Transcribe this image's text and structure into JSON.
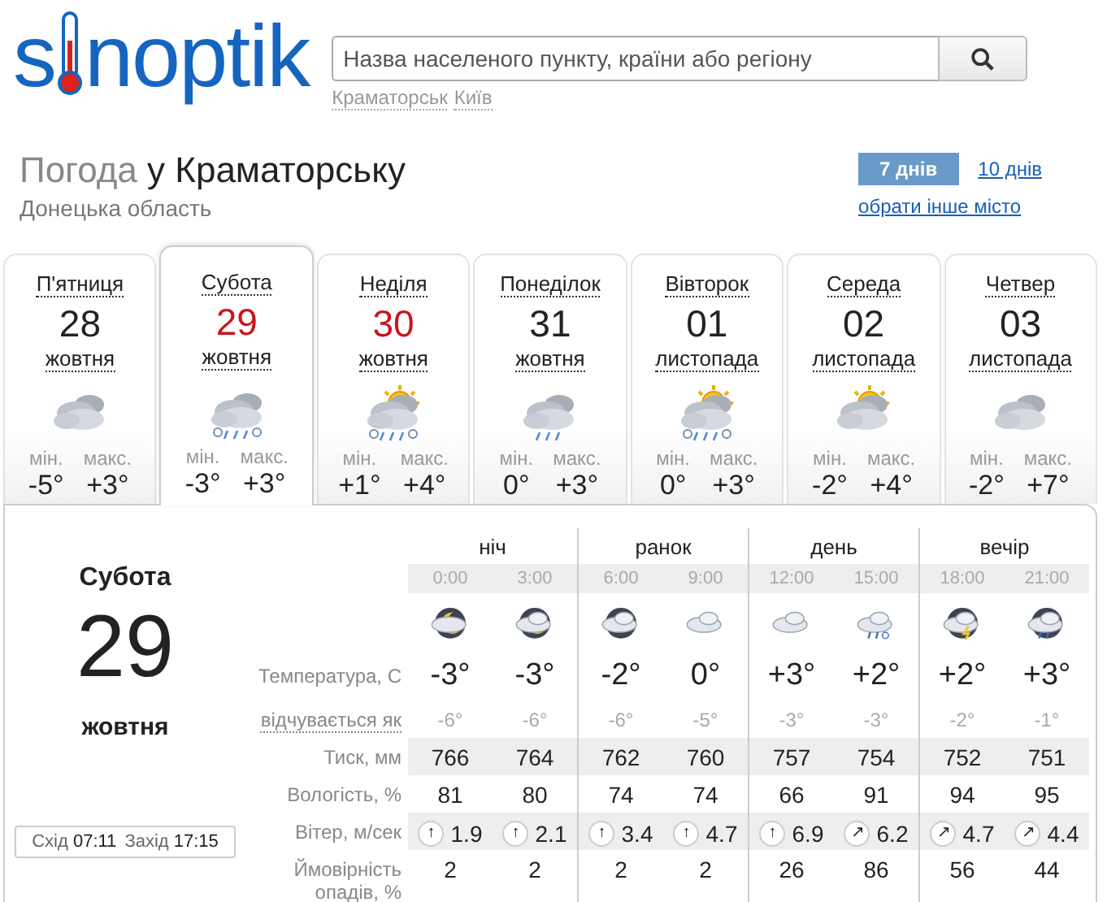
{
  "logo": {
    "left": "s",
    "right": "noptik"
  },
  "search": {
    "placeholder": "Назва населеного пункту, країни або регіону"
  },
  "recent_cities": [
    "Краматорськ",
    "Київ"
  ],
  "heading": {
    "prefix": "Погода",
    "city": "у Краматорську",
    "region": "Донецька область"
  },
  "range_tabs": [
    {
      "label": "7 днів",
      "selected": true
    },
    {
      "label": "10 днів",
      "selected": false
    }
  ],
  "change_city_link": "обрати інше місто",
  "days": [
    {
      "weekday": "П'ятниця",
      "date": "28",
      "month": "жовтня",
      "weekend": false,
      "selected": false,
      "kind": "cloudy",
      "min_label": "мін.",
      "min": "-5°",
      "max_label": "макс.",
      "max": "+3°"
    },
    {
      "weekday": "Субота",
      "date": "29",
      "month": "жовтня",
      "weekend": true,
      "selected": true,
      "kind": "cloud-snow-rain",
      "min_label": "мін.",
      "min": "-3°",
      "max_label": "макс.",
      "max": "+3°"
    },
    {
      "weekday": "Неділя",
      "date": "30",
      "month": "жовтня",
      "weekend": true,
      "selected": false,
      "kind": "sun-snow-rain",
      "min_label": "мін.",
      "min": "+1°",
      "max_label": "макс.",
      "max": "+4°"
    },
    {
      "weekday": "Понеділок",
      "date": "31",
      "month": "жовтня",
      "weekend": false,
      "selected": false,
      "kind": "cloud-rain",
      "min_label": "мін.",
      "min": "0°",
      "max_label": "макс.",
      "max": "+3°"
    },
    {
      "weekday": "Вівторок",
      "date": "01",
      "month": "листопада",
      "weekend": false,
      "selected": false,
      "kind": "sun-snow-rain",
      "min_label": "мін.",
      "min": "0°",
      "max_label": "макс.",
      "max": "+3°"
    },
    {
      "weekday": "Середа",
      "date": "02",
      "month": "листопада",
      "weekend": false,
      "selected": false,
      "kind": "sun-cloud",
      "min_label": "мін.",
      "min": "-2°",
      "max_label": "макс.",
      "max": "+4°"
    },
    {
      "weekday": "Четвер",
      "date": "03",
      "month": "листопада",
      "weekend": false,
      "selected": false,
      "kind": "cloudy",
      "min_label": "мін.",
      "min": "-2°",
      "max_label": "макс.",
      "max": "+7°"
    }
  ],
  "detail": {
    "weekday": "Субота",
    "date": "29",
    "month": "жовтня",
    "sunrise_label": "Схід",
    "sunrise": "07:11",
    "sunset_label": "Захід",
    "sunset": "17:15",
    "periods": [
      "ніч",
      "ранок",
      "день",
      "вечір"
    ],
    "times": [
      "0:00",
      "3:00",
      "6:00",
      "9:00",
      "12:00",
      "15:00",
      "18:00",
      "21:00"
    ],
    "icons": [
      {
        "kind": "moon"
      },
      {
        "kind": "moon-cloud"
      },
      {
        "kind": "night-cloud"
      },
      {
        "kind": "light-cloud"
      },
      {
        "kind": "light-cloud"
      },
      {
        "kind": "cloud-snow"
      },
      {
        "kind": "night-storm"
      },
      {
        "kind": "night-rain"
      }
    ],
    "temperature_label": "Температура, С",
    "temperature": [
      "-3°",
      "-3°",
      "-2°",
      "0°",
      "+3°",
      "+2°",
      "+2°",
      "+3°"
    ],
    "feels_label": "відчувається як",
    "feels": [
      "-6°",
      "-6°",
      "-6°",
      "-5°",
      "-3°",
      "-3°",
      "-2°",
      "-1°"
    ],
    "pressure_label": "Тиск, мм",
    "pressure": [
      "766",
      "764",
      "762",
      "760",
      "757",
      "754",
      "752",
      "751"
    ],
    "humidity_label": "Вологість, %",
    "humidity": [
      "81",
      "80",
      "74",
      "74",
      "66",
      "91",
      "94",
      "95"
    ],
    "wind_label": "Вітер, м/сек",
    "wind": [
      {
        "dir": "↑",
        "speed": "1.9"
      },
      {
        "dir": "↑",
        "speed": "2.1"
      },
      {
        "dir": "↑",
        "speed": "3.4"
      },
      {
        "dir": "↑",
        "speed": "4.7"
      },
      {
        "dir": "↑",
        "speed": "6.9"
      },
      {
        "dir": "↗",
        "speed": "6.2"
      },
      {
        "dir": "↗",
        "speed": "4.7"
      },
      {
        "dir": "↗",
        "speed": "4.4"
      }
    ],
    "precip_label": "Ймовірність опадів, %",
    "precip": [
      "2",
      "2",
      "2",
      "2",
      "26",
      "86",
      "56",
      "44"
    ]
  }
}
